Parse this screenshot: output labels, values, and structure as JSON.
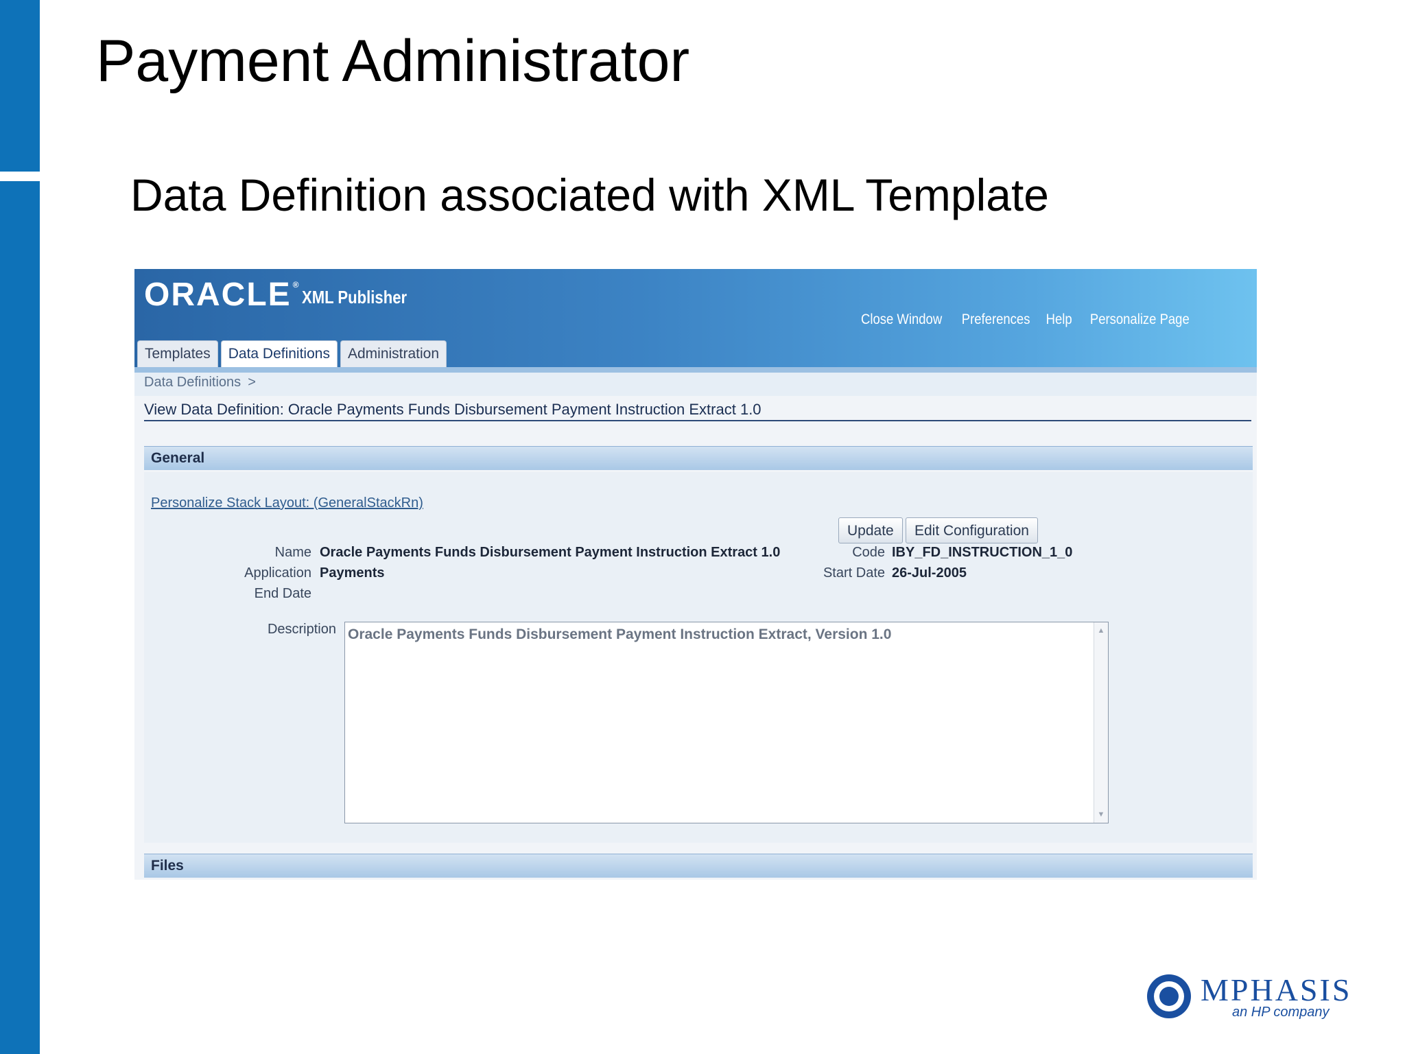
{
  "slide": {
    "title": "Payment Administrator",
    "subtitle": "Data Definition associated with XML Template",
    "accent_color": "#0e72b8"
  },
  "app": {
    "logo_text": "ORACLE",
    "logo_mark": "®",
    "product": "XML Publisher",
    "global_links": [
      "Close Window",
      "Preferences",
      "Help",
      "Personalize Page"
    ],
    "tabs": [
      {
        "label": "Templates",
        "active": false
      },
      {
        "label": "Data Definitions",
        "active": true
      },
      {
        "label": "Administration",
        "active": false
      }
    ]
  },
  "breadcrumb": {
    "label": "Data Definitions",
    "separator": ">"
  },
  "page_header": "View Data Definition: Oracle Payments Funds Disbursement Payment Instruction Extract 1.0",
  "general": {
    "section_title": "General",
    "personalize_link": "Personalize Stack Layout: (GeneralStackRn)",
    "buttons": {
      "update": "Update",
      "edit_configuration": "Edit Configuration"
    },
    "fields": {
      "name_label": "Name",
      "name_value": "Oracle Payments Funds Disbursement Payment Instruction Extract 1.0",
      "application_label": "Application",
      "application_value": "Payments",
      "end_date_label": "End Date",
      "code_label": "Code",
      "code_value": "IBY_FD_INSTRUCTION_1_0",
      "start_date_label": "Start Date",
      "start_date_value": "26-Jul-2005",
      "description_label": "Description",
      "description_value": "Oracle Payments Funds Disbursement Payment Instruction Extract, Version 1.0"
    }
  },
  "files": {
    "section_title": "Files"
  },
  "branding": {
    "company": "MPHASIS",
    "tagline": "an HP company"
  }
}
